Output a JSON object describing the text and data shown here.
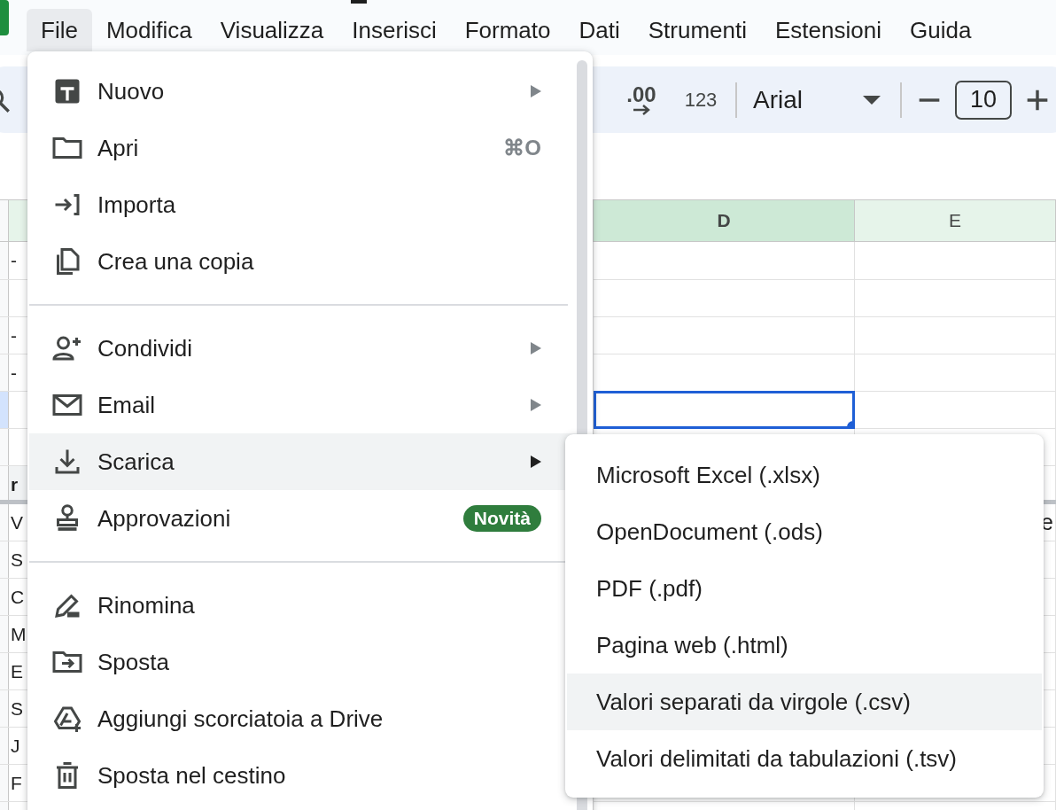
{
  "menubar": [
    {
      "label": "File",
      "selected": true
    },
    {
      "label": "Modifica",
      "selected": false
    },
    {
      "label": "Visualizza",
      "selected": false
    },
    {
      "label": "Inserisci",
      "selected": false
    },
    {
      "label": "Formato",
      "selected": false
    },
    {
      "label": "Dati",
      "selected": false
    },
    {
      "label": "Strumenti",
      "selected": false
    },
    {
      "label": "Estensioni",
      "selected": false
    },
    {
      "label": "Guida",
      "selected": false
    }
  ],
  "toolbar": {
    "decimal_button": ".00",
    "format_button": "123",
    "font": "Arial",
    "font_size": "10"
  },
  "sheet": {
    "columns": [
      {
        "label": "D",
        "selected": true
      },
      {
        "label": "E",
        "selected": false
      }
    ],
    "rows": [
      {
        "kind": "data",
        "selected": false,
        "column_1": "-"
      },
      {
        "kind": "data",
        "selected": false
      },
      {
        "kind": "data",
        "selected": false,
        "column_1": "-"
      },
      {
        "kind": "data",
        "selected": false,
        "column_1": "-"
      },
      {
        "kind": "data",
        "selected": true
      },
      {
        "kind": "data",
        "selected": false
      },
      {
        "kind": "header",
        "selected": false,
        "column_1": "r"
      },
      {
        "kind": "data",
        "selected": false,
        "column_1": "V",
        "column_e": "e"
      },
      {
        "kind": "data",
        "selected": false,
        "column_1": "S"
      },
      {
        "kind": "data",
        "selected": false,
        "column_1": "C"
      },
      {
        "kind": "data",
        "selected": false,
        "column_1": "M"
      },
      {
        "kind": "data",
        "selected": false,
        "column_1": "E"
      },
      {
        "kind": "data",
        "selected": false,
        "column_1": "S"
      },
      {
        "kind": "data",
        "selected": false,
        "column_1": "J"
      },
      {
        "kind": "data",
        "selected": false,
        "column_1": "F"
      },
      {
        "kind": "data",
        "selected": false
      }
    ]
  },
  "file_menu": {
    "sections": [
      {
        "items": [
          {
            "label": "Nuovo",
            "submenu": true,
            "selected": false
          },
          {
            "label": "Apri",
            "shortcut": "⌘O",
            "submenu": false,
            "selected": false
          },
          {
            "label": "Importa",
            "submenu": false,
            "selected": false
          },
          {
            "label": "Crea una copia",
            "submenu": false,
            "selected": false
          }
        ]
      },
      {
        "items": [
          {
            "label": "Condividi",
            "submenu": true,
            "selected": false
          },
          {
            "label": "Email",
            "submenu": true,
            "selected": false
          },
          {
            "label": "Scarica",
            "submenu": true,
            "selected": true
          },
          {
            "label": "Approvazioni",
            "badge": "Novità",
            "submenu": false,
            "selected": false
          }
        ]
      },
      {
        "items": [
          {
            "label": "Rinomina",
            "submenu": false,
            "selected": false
          },
          {
            "label": "Sposta",
            "submenu": false,
            "selected": false
          },
          {
            "label": "Aggiungi scorciatoia a Drive",
            "submenu": false,
            "selected": false
          },
          {
            "label": "Sposta nel cestino",
            "submenu": false,
            "selected": false
          }
        ]
      }
    ]
  },
  "download_submenu": {
    "items": [
      {
        "label": "Microsoft Excel (.xlsx)",
        "selected": false
      },
      {
        "label": "OpenDocument (.ods)",
        "selected": false
      },
      {
        "label": "PDF (.pdf)",
        "selected": false
      },
      {
        "label": "Pagina web (.html)",
        "selected": false
      },
      {
        "label": "Valori separati da virgole (.csv)",
        "selected": true
      },
      {
        "label": "Valori delimitati da tabulazioni (.tsv)",
        "selected": false
      }
    ]
  }
}
